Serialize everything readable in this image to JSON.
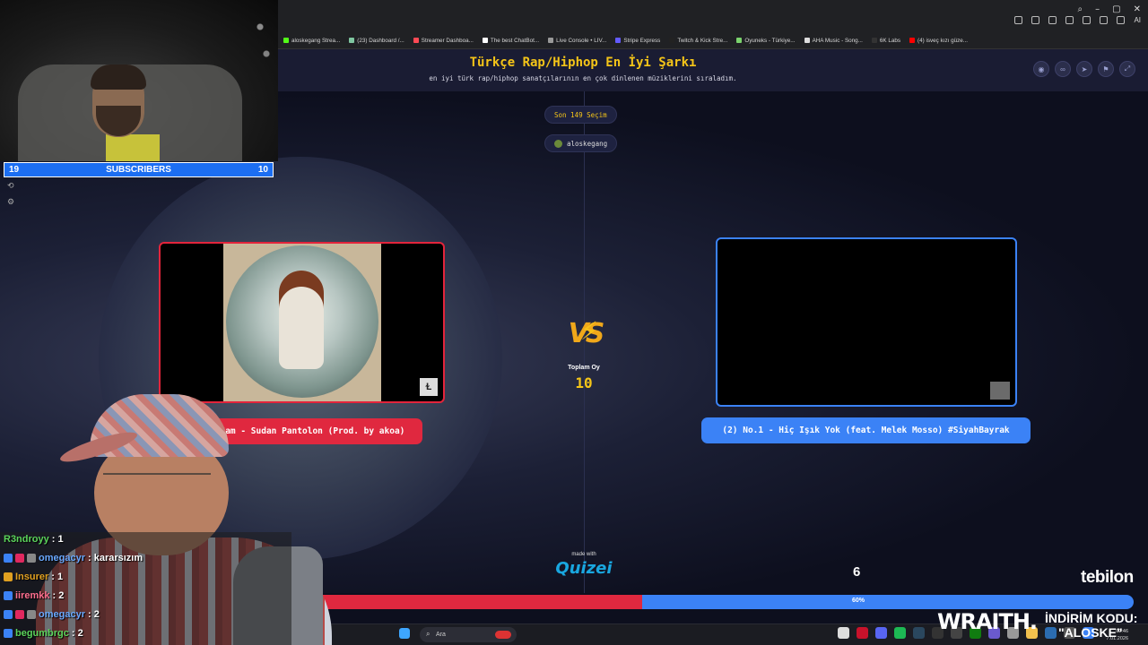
{
  "browser": {
    "bookmarks": [
      "aloskegang Strea...",
      "(23) Dashboard /...",
      "Streamer Dashboa...",
      "The best ChatBot...",
      "Live Console • LIV...",
      "Stripe Express",
      "Twitch & Kick Stre...",
      "Oyuneks - Türkiye...",
      "AHA Music - Song...",
      "6K Labs",
      "(4) isveç kızı güze..."
    ],
    "toolbar_label": "AI"
  },
  "page": {
    "title": "Türkçe Rap/Hiphop En İyi Şarkı",
    "subtitle": "en iyi türk rap/hiphop sanatçılarının en çok dinlenen müziklerini sıraladım.",
    "round_pill": "Son 149 Seçim",
    "creator": "aloskegang",
    "total_votes_label": "Toplam Oy",
    "total_votes": "10",
    "vs_text": "VS",
    "made_with": "made with",
    "brand": "Quizei",
    "left": {
      "label": "(1) Şam - Sudan Pantolon (Prod. by akoa)",
      "score": "4"
    },
    "right": {
      "label": "(2) No.1 - Hiç Işık Yok (feat. Melek Mosso) #SiyahBayrak",
      "score": "6",
      "percent_label": "60%"
    },
    "vote_share_left": 0.4,
    "colors": {
      "accent": "#f5c518",
      "left": "#e0283f",
      "right": "#3b82f6"
    }
  },
  "overlay": {
    "subs_left": "19",
    "subs_label": "SUBSCRIBERS",
    "subs_right": "10",
    "sponsor_brand": "tebilon",
    "wraith": "WRAITH.",
    "discount_label": "İNDİRİM KODU:",
    "discount_code": "\"ALOSKE\"",
    "chat": [
      {
        "user": "R3ndroyy",
        "text": ": 1",
        "color": "#5bd45b"
      },
      {
        "user": "omegacyr",
        "text": ": kararsızım",
        "color": "#6aa9ff"
      },
      {
        "user": "Insurer",
        "text": ": 1",
        "color": "#e0a020"
      },
      {
        "user": "iiremkk",
        "text": ": 2",
        "color": "#ff6f8f"
      },
      {
        "user": "omegacyr",
        "text": ": 2",
        "color": "#6aa9ff"
      },
      {
        "user": "begumbrgc",
        "text": ": 2",
        "color": "#5bd45b"
      }
    ]
  },
  "taskbar": {
    "search_placeholder": "Ara",
    "time": "02:46",
    "date": "7.01.2026"
  }
}
